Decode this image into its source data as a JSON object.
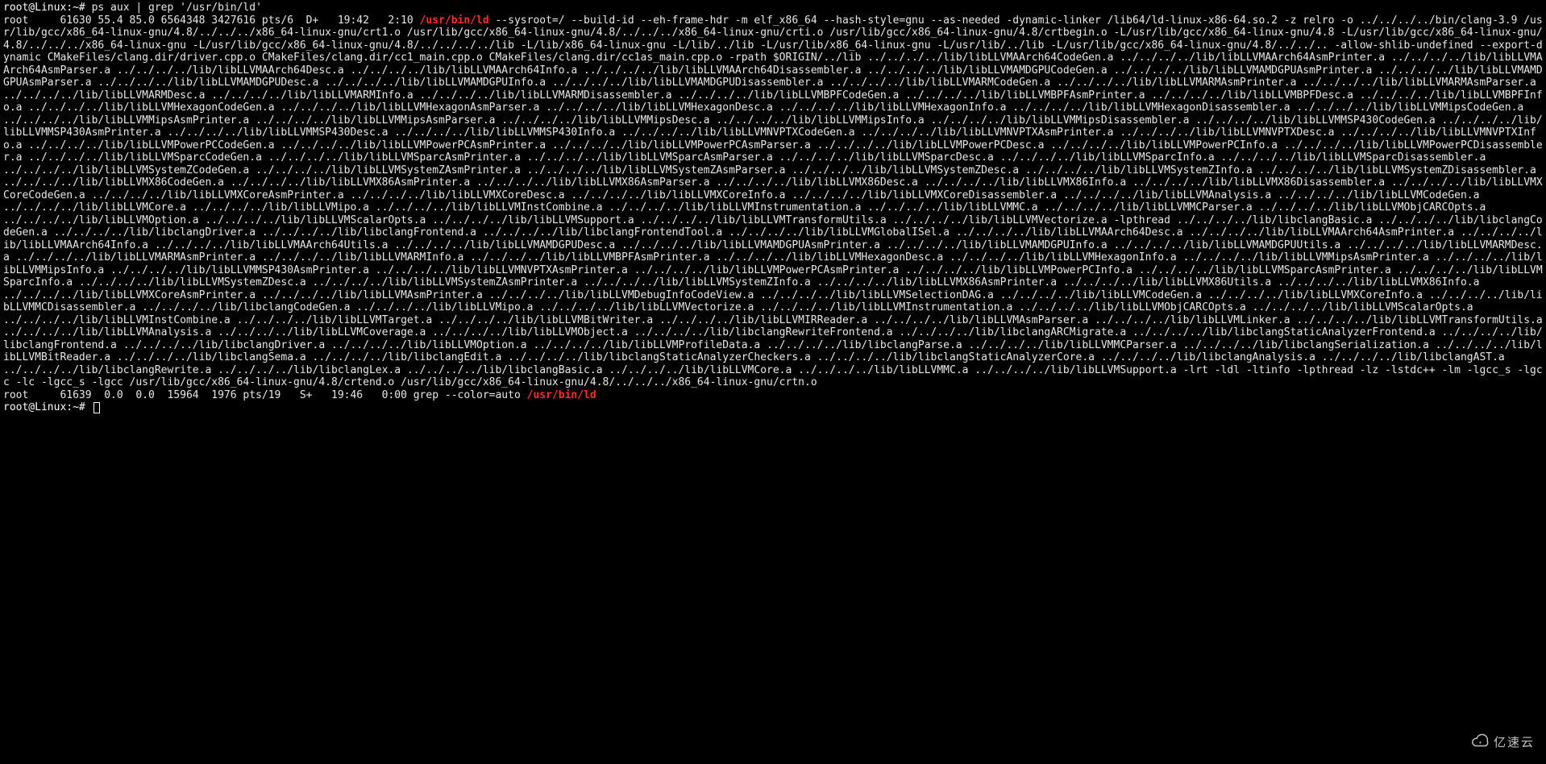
{
  "prompt": "root@Linux:~#",
  "command": "ps aux | grep '/usr/bin/ld'",
  "ps_line1_pre": "root     61630 55.4 85.0 6564348 3427616 pts/6  D+   19:42   2:10 ",
  "ps_line1_hl": "/usr/bin/ld",
  "ps_line1_post": " --sysroot=/ --build-id --eh-frame-hdr -m elf_x86_64 --hash-style=gnu --as-needed -dynamic-linker /lib64/ld-linux-x86-64.so.2 -z relro -o ../../../../bin/clang-3.9 /usr/lib/gcc/x86_64-linux-gnu/4.8/../../../x86_64-linux-gnu/crt1.o /usr/lib/gcc/x86_64-linux-gnu/4.8/../../../x86_64-linux-gnu/crti.o /usr/lib/gcc/x86_64-linux-gnu/4.8/crtbegin.o -L/usr/lib/gcc/x86_64-linux-gnu/4.8 -L/usr/lib/gcc/x86_64-linux-gnu/4.8/../../../x86_64-linux-gnu -L/usr/lib/gcc/x86_64-linux-gnu/4.8/../../../../lib -L/lib/x86_64-linux-gnu -L/lib/../lib -L/usr/lib/x86_64-linux-gnu -L/usr/lib/../lib -L/usr/lib/gcc/x86_64-linux-gnu/4.8/../../.. -allow-shlib-undefined --export-dynamic CMakeFiles/clang.dir/driver.cpp.o CMakeFiles/clang.dir/cc1_main.cpp.o CMakeFiles/clang.dir/cc1as_main.cpp.o -rpath $ORIGIN/../lib ../../../../lib/libLLVMAArch64CodeGen.a ../../../../lib/libLLVMAArch64AsmPrinter.a ../../../../lib/libLLVMAArch64AsmParser.a ../../../../lib/libLLVMAArch64Desc.a ../../../../lib/libLLVMAArch64Info.a ../../../../lib/libLLVMAArch64Disassembler.a ../../../../lib/libLLVMAMDGPUCodeGen.a ../../../../lib/libLLVMAMDGPUAsmPrinter.a ../../../../lib/libLLVMAMDGPUAsmParser.a ../../../../lib/libLLVMAMDGPUDesc.a ../../../../lib/libLLVMAMDGPUInfo.a ../../../../lib/libLLVMAMDGPUDisassembler.a ../../../../lib/libLLVMARMCodeGen.a ../../../../lib/libLLVMARMAsmPrinter.a ../../../../lib/libLLVMARMAsmParser.a ../../../../lib/libLLVMARMDesc.a ../../../../lib/libLLVMARMInfo.a ../../../../lib/libLLVMARMDisassembler.a ../../../../lib/libLLVMBPFCodeGen.a ../../../../lib/libLLVMBPFAsmPrinter.a ../../../../lib/libLLVMBPFDesc.a ../../../../lib/libLLVMBPFInfo.a ../../../../lib/libLLVMHexagonCodeGen.a ../../../../lib/libLLVMHexagonAsmParser.a ../../../../lib/libLLVMHexagonDesc.a ../../../../lib/libLLVMHexagonInfo.a ../../../../lib/libLLVMHexagonDisassembler.a ../../../../lib/libLLVMMipsCodeGen.a ../../../../lib/libLLVMMipsAsmPrinter.a ../../../../lib/libLLVMMipsAsmParser.a ../../../../lib/libLLVMMipsDesc.a ../../../../lib/libLLVMMipsInfo.a ../../../../lib/libLLVMMipsDisassembler.a ../../../../lib/libLLVMMSP430CodeGen.a ../../../../lib/libLLVMMSP430AsmPrinter.a ../../../../lib/libLLVMMSP430Desc.a ../../../../lib/libLLVMMSP430Info.a ../../../../lib/libLLVMNVPTXCodeGen.a ../../../../lib/libLLVMNVPTXAsmPrinter.a ../../../../lib/libLLVMNVPTXDesc.a ../../../../lib/libLLVMNVPTXInfo.a ../../../../lib/libLLVMPowerPCCodeGen.a ../../../../lib/libLLVMPowerPCAsmPrinter.a ../../../../lib/libLLVMPowerPCAsmParser.a ../../../../lib/libLLVMPowerPCDesc.a ../../../../lib/libLLVMPowerPCInfo.a ../../../../lib/libLLVMPowerPCDisassembler.a ../../../../lib/libLLVMSparcCodeGen.a ../../../../lib/libLLVMSparcAsmPrinter.a ../../../../lib/libLLVMSparcAsmParser.a ../../../../lib/libLLVMSparcDesc.a ../../../../lib/libLLVMSparcInfo.a ../../../../lib/libLLVMSparcDisassembler.a ../../../../lib/libLLVMSystemZCodeGen.a ../../../../lib/libLLVMSystemZAsmPrinter.a ../../../../lib/libLLVMSystemZAsmParser.a ../../../../lib/libLLVMSystemZDesc.a ../../../../lib/libLLVMSystemZInfo.a ../../../../lib/libLLVMSystemZDisassembler.a ../../../../lib/libLLVMX86CodeGen.a ../../../../lib/libLLVMX86AsmPrinter.a ../../../../lib/libLLVMX86AsmParser.a ../../../../lib/libLLVMX86Desc.a ../../../../lib/libLLVMX86Info.a ../../../../lib/libLLVMX86Disassembler.a ../../../../lib/libLLVMXCoreCodeGen.a ../../../../lib/libLLVMXCoreAsmPrinter.a ../../../../lib/libLLVMXCoreDesc.a ../../../../lib/libLLVMXCoreInfo.a ../../../../lib/libLLVMXCoreDisassembler.a ../../../../lib/libLLVMAnalysis.a ../../../../lib/libLLVMCodeGen.a ../../../../lib/libLLVMCore.a ../../../../lib/libLLVMipo.a ../../../../lib/libLLVMInstCombine.a ../../../../lib/libLLVMInstrumentation.a ../../../../lib/libLLVMMC.a ../../../../lib/libLLVMMCParser.a ../../../../lib/libLLVMObjCARCOpts.a ../../../../lib/libLLVMOption.a ../../../../lib/libLLVMScalarOpts.a ../../../../lib/libLLVMSupport.a ../../../../lib/libLLVMTransformUtils.a ../../../../lib/libLLVMVectorize.a -lpthread ../../../../lib/libclangBasic.a ../../../../lib/libclangCodeGen.a ../../../../lib/libclangDriver.a ../../../../lib/libclangFrontend.a ../../../../lib/libclangFrontendTool.a ../../../../lib/libLLVMGlobalISel.a ../../../../lib/libLLVMAArch64Desc.a ../../../../lib/libLLVMAArch64AsmPrinter.a ../../../../lib/libLLVMAArch64Info.a ../../../../lib/libLLVMAArch64Utils.a ../../../../lib/libLLVMAMDGPUDesc.a ../../../../lib/libLLVMAMDGPUAsmPrinter.a ../../../../lib/libLLVMAMDGPUInfo.a ../../../../lib/libLLVMAMDGPUUtils.a ../../../../lib/libLLVMARMDesc.a ../../../../lib/libLLVMARMAsmPrinter.a ../../../../lib/libLLVMARMInfo.a ../../../../lib/libLLVMBPFAsmPrinter.a ../../../../lib/libLLVMHexagonDesc.a ../../../../lib/libLLVMHexagonInfo.a ../../../../lib/libLLVMMipsAsmPrinter.a ../../../../lib/libLLVMMipsInfo.a ../../../../lib/libLLVMMSP430AsmPrinter.a ../../../../lib/libLLVMNVPTXAsmPrinter.a ../../../../lib/libLLVMPowerPCAsmPrinter.a ../../../../lib/libLLVMPowerPCInfo.a ../../../../lib/libLLVMSparcAsmPrinter.a ../../../../lib/libLLVMSparcInfo.a ../../../../lib/libLLVMSystemZDesc.a ../../../../lib/libLLVMSystemZAsmPrinter.a ../../../../lib/libLLVMSystemZInfo.a ../../../../lib/libLLVMX86AsmPrinter.a ../../../../lib/libLLVMX86Utils.a ../../../../lib/libLLVMX86Info.a ../../../../lib/libLLVMXCoreAsmPrinter.a ../../../../lib/libLLVMAsmPrinter.a ../../../../lib/libLLVMDebugInfoCodeView.a ../../../../lib/libLLVMSelectionDAG.a ../../../../lib/libLLVMCodeGen.a ../../../../lib/libLLVMXCoreInfo.a ../../../../lib/libLLVMMCDisassembler.a ../../../../lib/libclangCodeGen.a ../../../../lib/libLLVMipo.a ../../../../lib/libLLVMVectorize.a ../../../../lib/libLLVMInstrumentation.a ../../../../lib/libLLVMObjCARCOpts.a ../../../../lib/libLLVMScalarOpts.a ../../../../lib/libLLVMInstCombine.a ../../../../lib/libLLVMTarget.a ../../../../lib/libLLVMBitWriter.a ../../../../lib/libLLVMIRReader.a ../../../../lib/libLLVMAsmParser.a ../../../../lib/libLLVMLinker.a ../../../../lib/libLLVMTransformUtils.a ../../../../lib/libLLVMAnalysis.a ../../../../lib/libLLVMCoverage.a ../../../../lib/libLLVMObject.a ../../../../lib/libclangRewriteFrontend.a ../../../../lib/libclangARCMigrate.a ../../../../lib/libclangStaticAnalyzerFrontend.a ../../../../lib/libclangFrontend.a ../../../../lib/libclangDriver.a ../../../../lib/libLLVMOption.a ../../../../lib/libLLVMProfileData.a ../../../../lib/libclangParse.a ../../../../lib/libLLVMMCParser.a ../../../../lib/libclangSerialization.a ../../../../lib/libLLVMBitReader.a ../../../../lib/libclangSema.a ../../../../lib/libclangEdit.a ../../../../lib/libclangStaticAnalyzerCheckers.a ../../../../lib/libclangStaticAnalyzerCore.a ../../../../lib/libclangAnalysis.a ../../../../lib/libclangAST.a ../../../../lib/libclangRewrite.a ../../../../lib/libclangLex.a ../../../../lib/libclangBasic.a ../../../../lib/libLLVMCore.a ../../../../lib/libLLVMMC.a ../../../../lib/libLLVMSupport.a -lrt -ldl -ltinfo -lpthread -lz -lstdc++ -lm -lgcc_s -lgcc -lc -lgcc_s -lgcc /usr/lib/gcc/x86_64-linux-gnu/4.8/crtend.o /usr/lib/gcc/x86_64-linux-gnu/4.8/../../../x86_64-linux-gnu/crtn.o",
  "ps_line2_pre": "root     61639  0.0  0.0  15964  1976 pts/19   S+   19:46   0:00 grep --color=auto ",
  "ps_line2_hl": "/usr/bin/ld",
  "watermark_text": "亿速云"
}
